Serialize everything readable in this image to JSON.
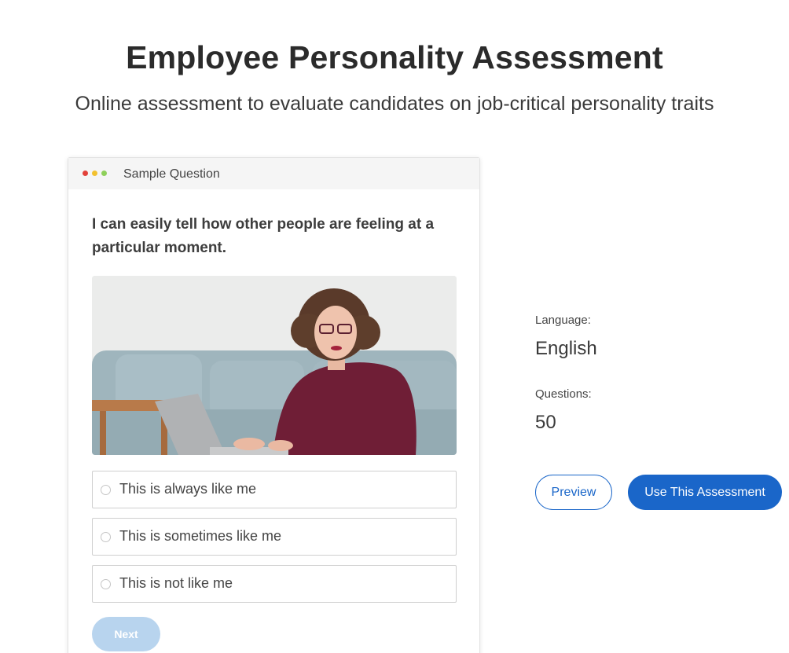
{
  "hero": {
    "title": "Employee Personality Assessment",
    "subtitle": "Online assessment to evaluate candidates on job-critical personality traits"
  },
  "sample": {
    "header_label": "Sample Question",
    "question": "I can easily tell how other people are feeling at a particular moment.",
    "options": [
      {
        "label": "This is always like me",
        "selected": false
      },
      {
        "label": "This is sometimes like me",
        "selected": false
      },
      {
        "label": "This is not like me",
        "selected": false
      }
    ],
    "next_label": "Next"
  },
  "info": {
    "language_label": "Language:",
    "language_value": "English",
    "questions_label": "Questions:",
    "questions_value": "50"
  },
  "actions": {
    "preview_label": "Preview",
    "use_label": "Use This Assessment"
  },
  "colors": {
    "accent": "#1a66c9",
    "next_disabled": "#b8d4ee",
    "window_dots": [
      "#e2413a",
      "#f2c12e",
      "#8ed05a"
    ]
  }
}
